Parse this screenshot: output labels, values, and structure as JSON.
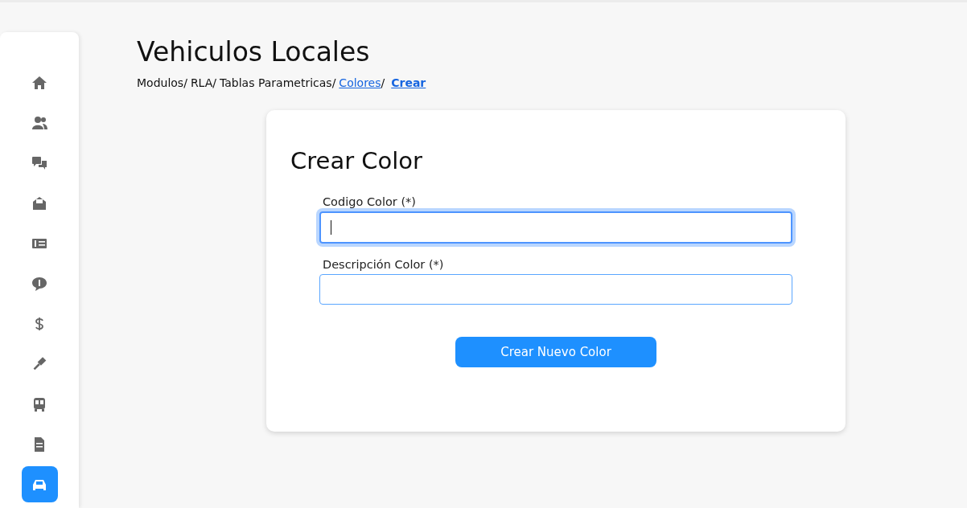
{
  "sidebar": {
    "items": [
      {
        "kind": "home",
        "selected": false
      },
      {
        "kind": "users",
        "selected": false
      },
      {
        "kind": "chat",
        "selected": false
      },
      {
        "kind": "envelope",
        "selected": false
      },
      {
        "kind": "card",
        "selected": false
      },
      {
        "kind": "bubble",
        "selected": false
      },
      {
        "kind": "dollar",
        "selected": false
      },
      {
        "kind": "gavel",
        "selected": false
      },
      {
        "kind": "bus",
        "selected": false
      },
      {
        "kind": "document",
        "selected": false
      },
      {
        "kind": "car",
        "selected": true
      }
    ]
  },
  "page": {
    "title": "Vehiculos Locales",
    "breadcrumb": [
      {
        "label": "Modulos/",
        "kind": "text"
      },
      {
        "label": "RLA/",
        "kind": "text"
      },
      {
        "label": "Tablas Parametricas/",
        "kind": "text"
      },
      {
        "label": "Colores",
        "kind": "link"
      },
      {
        "label": "/",
        "kind": "text"
      },
      {
        "label": "Crear",
        "kind": "current"
      }
    ]
  },
  "form": {
    "title": "Crear Color",
    "fields": [
      {
        "label": "Codigo Color (*)",
        "focused": true
      },
      {
        "label": "Descripción Color (*)",
        "focused": false
      }
    ],
    "submit": "Crear Nuevo Color"
  }
}
